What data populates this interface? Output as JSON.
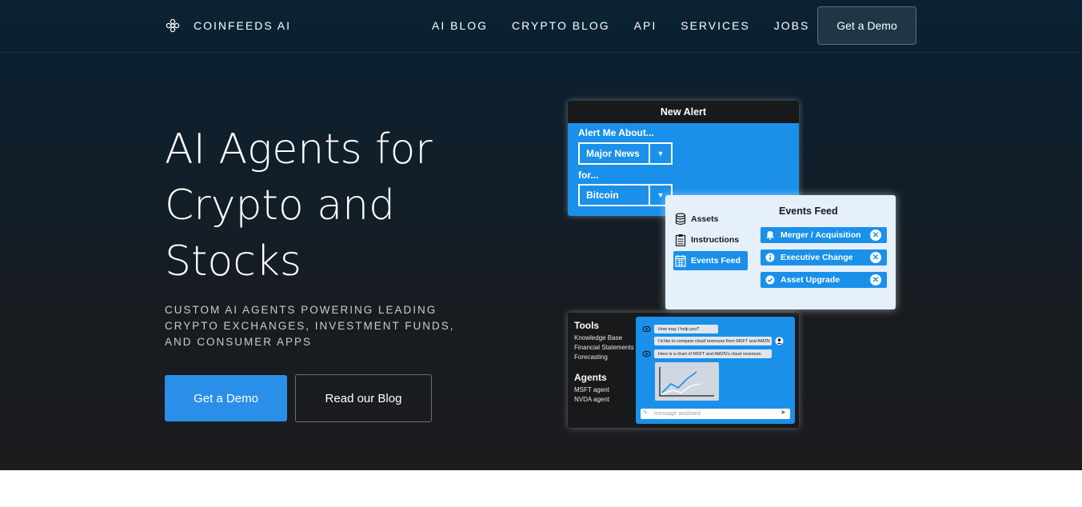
{
  "brand": {
    "name": "COINFEEDS AI",
    "logo_icon": "knot-logo-icon"
  },
  "nav": {
    "links": [
      "AI BLOG",
      "CRYPTO BLOG",
      "API",
      "SERVICES",
      "JOBS"
    ],
    "cta_label": "Get a Demo"
  },
  "hero": {
    "title": "AI Agents for Crypto and Stocks",
    "subtitle": "CUSTOM AI AGENTS POWERING LEADING CRYPTO EXCHANGES, INVESTMENT FUNDS, AND CONSUMER APPS",
    "primary_cta": "Get a Demo",
    "secondary_cta": "Read our Blog"
  },
  "illustration": {
    "alert_card": {
      "title": "New Alert",
      "about_label": "Alert Me About...",
      "about_value": "Major News",
      "for_label": "for...",
      "for_value": "Bitcoin"
    },
    "events_card": {
      "sidebar": [
        "Assets",
        "Instructions",
        "Events Feed"
      ],
      "title": "Events Feed",
      "chips": [
        "Merger / Acquisition",
        "Executive Change",
        "Asset Upgrade"
      ]
    },
    "chat_card": {
      "tools_heading": "Tools",
      "tools": [
        "Knowledge Base",
        "Financial Statements",
        "Forecasting"
      ],
      "agents_heading": "Agents",
      "agents": [
        "MSFT agent",
        "NVDA agent"
      ],
      "messages": [
        "How may I help you?",
        "I'd like to compare cloud revenues from MSFT and AMZN",
        "Here is a chart of MSFT and AMZN's cloud revenues."
      ],
      "input_placeholder": "message assistant"
    }
  },
  "colors": {
    "accent": "#2a8fe8",
    "card_blue": "#1a90ea",
    "hero_top": "#0a2233",
    "hero_bottom": "#1b1c1e"
  }
}
